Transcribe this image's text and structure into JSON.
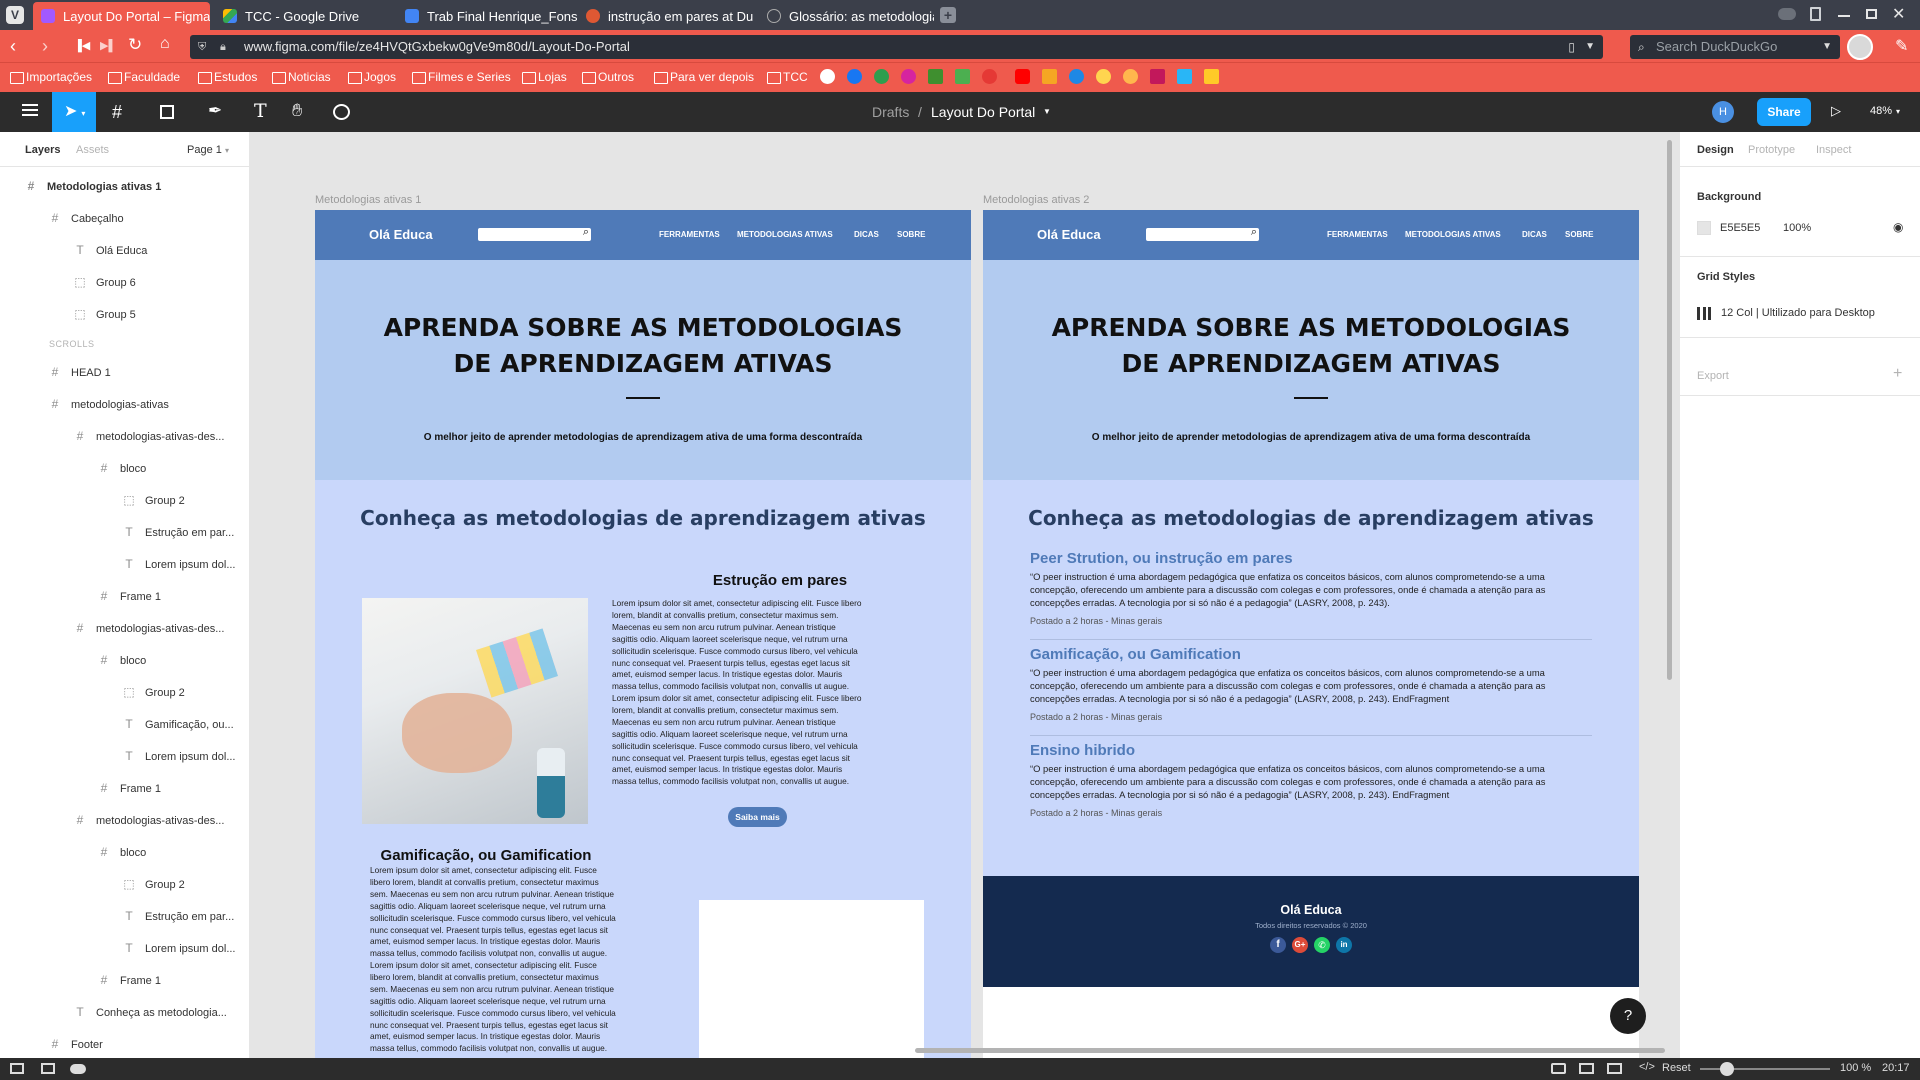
{
  "browser": {
    "tabs": [
      {
        "label": "Layout Do Portal – Figma",
        "active": true
      },
      {
        "label": "TCC - Google Drive"
      },
      {
        "label": "Trab Final Henrique_Fonse"
      },
      {
        "label": "instrução em pares at Duck"
      },
      {
        "label": "Glossário: as metodologias"
      }
    ],
    "url": "www.figma.com/file/ze4HVQtGxbekw0gVe9m80d/Layout-Do-Portal",
    "search_placeholder": "Search DuckDuckGo",
    "bookmarks": [
      "Importações",
      "Faculdade",
      "Estudos",
      "Noticias",
      "Jogos",
      "Filmes e Series",
      "Lojas",
      "Outros",
      "Para ver depois",
      "TCC"
    ],
    "accent": "#EF5A4D"
  },
  "toolbar": {
    "breadcrumb_root": "Drafts",
    "separator": "/",
    "file_name": "Layout Do Portal",
    "user_initial": "H",
    "share_label": "Share",
    "zoom": "48%"
  },
  "layers_panel": {
    "tab_layers": "Layers",
    "tab_assets": "Assets",
    "page": "Page 1",
    "items": [
      {
        "label": "Metodologias ativas 1",
        "icon": "#"
      },
      {
        "label": "Cabeçalho",
        "icon": "#"
      },
      {
        "label": "Olá Educa",
        "icon": "T"
      },
      {
        "label": "Group 6",
        "icon": "⬚"
      },
      {
        "label": "Group 5",
        "icon": "⬚"
      },
      {
        "label": "SCROLLS",
        "icon": ""
      },
      {
        "label": "HEAD 1",
        "icon": "#"
      },
      {
        "label": "metodologias-ativas",
        "icon": "#"
      },
      {
        "label": "metodologias-ativas-des...",
        "icon": "#"
      },
      {
        "label": "bloco",
        "icon": "#"
      },
      {
        "label": "Group 2",
        "icon": "⬚"
      },
      {
        "label": "Estrução em par...",
        "icon": "T"
      },
      {
        "label": "Lorem ipsum dol...",
        "icon": "T"
      },
      {
        "label": "Frame 1",
        "icon": "#"
      },
      {
        "label": "metodologias-ativas-des...",
        "icon": "#"
      },
      {
        "label": "bloco",
        "icon": "#"
      },
      {
        "label": "Group 2",
        "icon": "⬚"
      },
      {
        "label": "Gamificação, ou...",
        "icon": "T"
      },
      {
        "label": "Lorem ipsum dol...",
        "icon": "T"
      },
      {
        "label": "Frame 1",
        "icon": "#"
      },
      {
        "label": "metodologias-ativas-des...",
        "icon": "#"
      },
      {
        "label": "bloco",
        "icon": "#"
      },
      {
        "label": "Group 2",
        "icon": "⬚"
      },
      {
        "label": "Estrução em par...",
        "icon": "T"
      },
      {
        "label": "Lorem ipsum dol...",
        "icon": "T"
      },
      {
        "label": "Frame 1",
        "icon": "#"
      },
      {
        "label": "Conheça as metodologia...",
        "icon": "T"
      },
      {
        "label": "Footer",
        "icon": "#"
      }
    ]
  },
  "design_panel": {
    "tabs": [
      "Design",
      "Prototype",
      "Inspect"
    ],
    "background_label": "Background",
    "bg_hex": "E5E5E5",
    "bg_opacity": "100%",
    "grid_label": "Grid Styles",
    "grid_style": "12 Col | Ultilizado para Desktop",
    "export_label": "Export"
  },
  "frames": {
    "frame1_label": "Metodologias ativas 1",
    "frame2_label": "Metodologias ativas 2",
    "brand": "Olá Educa",
    "nav": [
      "FERRAMENTAS",
      "METODOLOGIAS ATIVAS",
      "DICAS",
      "SOBRE"
    ],
    "hero_title": "APRENDA SOBRE AS METODOLOGIAS DE APRENDIZAGEM ATIVAS",
    "hero_sub": "O melhor jeito de aprender metodologias de aprendizagem ativa de uma forma descontraída",
    "section_title": "Conheça as metodologias de aprendizagem ativas",
    "block1_title": "Estrução em pares",
    "block2_title": "Gamificação, ou Gamification",
    "lorem": "Lorem ipsum dolor sit amet, consectetur adipiscing elit. Fusce libero lorem, blandit at convallis pretium, consectetur maximus sem. Maecenas eu sem non arcu rutrum pulvinar. Aenean tristique sagittis odio. Aliquam laoreet scelerisque neque, vel rutrum urna sollicitudin scelerisque. Fusce commodo cursus libero, vel vehicula nunc consequat vel. Praesent turpis tellus, egestas eget lacus sit amet, euismod semper lacus. In tristique egestas dolor. Mauris massa tellus, commodo facilisis volutpat non, convallis ut augue.",
    "cta": "Saiba mais",
    "articles": [
      {
        "title": "Peer Strution, ou instrução em pares",
        "body": "“O peer instruction é uma abordagem pedagógica que enfatiza os conceitos básicos, com alunos comprometendo-se a uma concepção, oferecendo um ambiente para a discussão com colegas e com professores, onde é chamada a atenção para as concepções erradas. A tecnologia por si só não é a pedagogia” (LASRY, 2008, p. 243).",
        "meta": "Postado a 2 horas - Minas gerais"
      },
      {
        "title": "Gamificação, ou Gamification",
        "body": "“O peer instruction é uma abordagem pedagógica que enfatiza os conceitos básicos, com alunos comprometendo-se a uma concepção, oferecendo um ambiente para a discussão com colegas e com professores, onde é chamada a atenção para as concepções erradas. A tecnologia por si só não é a pedagogia” (LASRY, 2008, p. 243). EndFragment",
        "meta": "Postado a 2 horas - Minas gerais"
      },
      {
        "title": "Ensino hibrido",
        "body": "“O peer instruction é uma abordagem pedagógica que enfatiza os conceitos básicos, com alunos comprometendo-se a uma concepção, oferecendo um ambiente para a discussão com colegas e com professores, onde é chamada a atenção para as concepções erradas. A tecnologia por si só não é a pedagogia” (LASRY, 2008, p. 243). EndFragment",
        "meta": "Postado a 2 horas - Minas gerais"
      }
    ],
    "footer_brand": "Olá Educa",
    "footer_rights": "Todos direitos reservados © 2020"
  },
  "status": {
    "reset": "Reset",
    "zoom": "100 %",
    "time": "20:17"
  },
  "colors": {
    "figma_blue": "#18A0FB",
    "site_nav": "#4F7AB8",
    "hero_bg": "#B2CBF0",
    "section_bg": "#C9D7FB",
    "footer_bg": "#142A4F"
  }
}
